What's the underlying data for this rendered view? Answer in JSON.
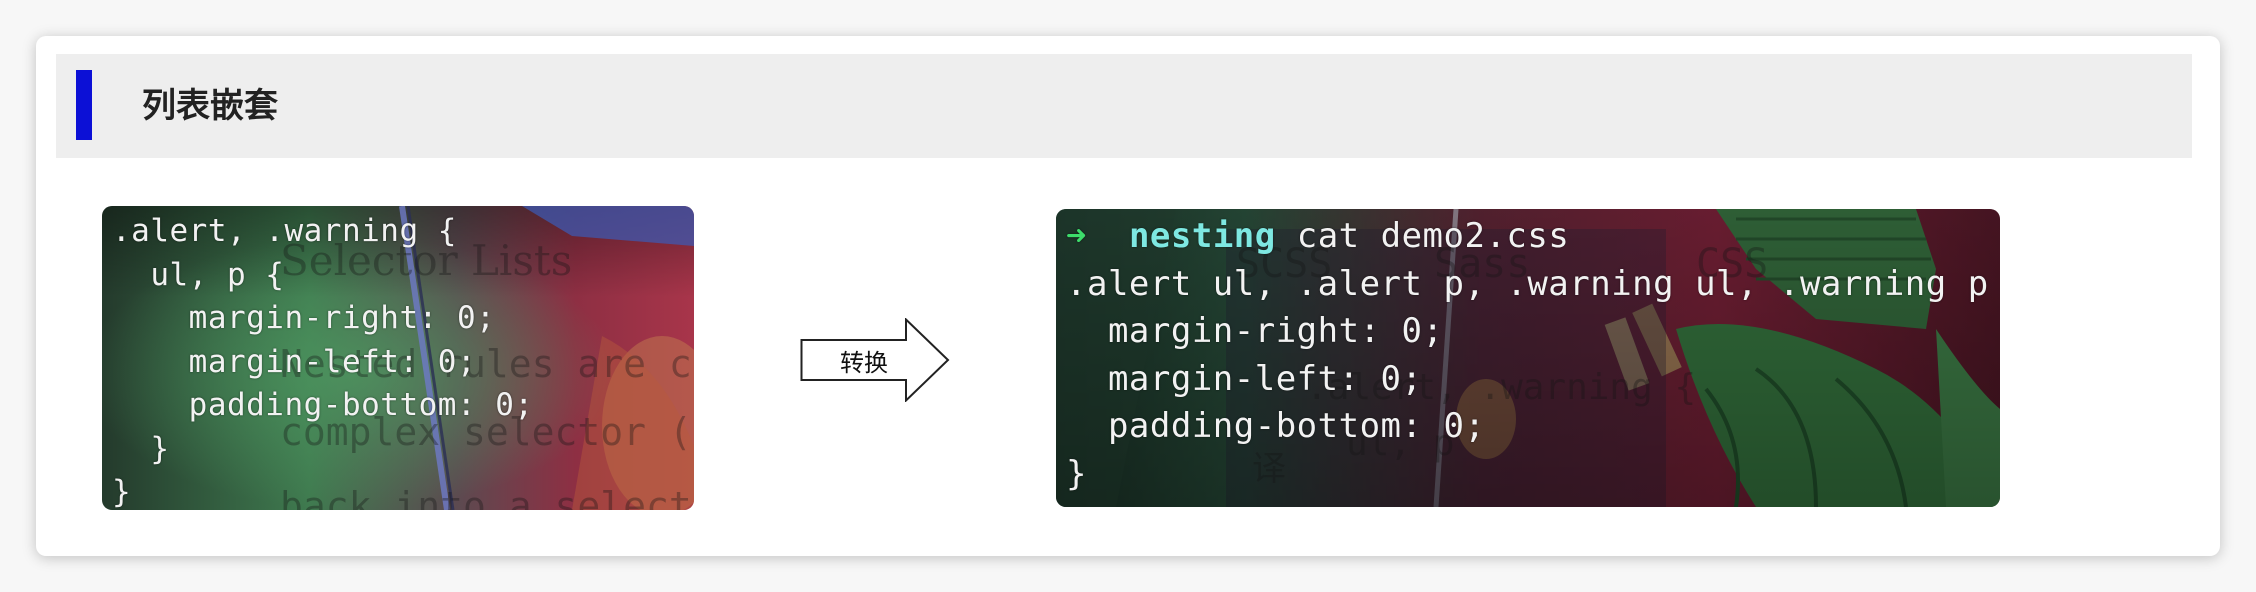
{
  "section": {
    "title": "列表嵌套",
    "accent_color": "#0c10d6"
  },
  "left_terminal": {
    "lines": [
      ".alert, .warning {",
      "  ul, p {",
      "    margin-right: 0;",
      "    margin-left: 0;",
      "    padding-bottom: 0;",
      "  }",
      "}"
    ],
    "background_text": [
      "Selector Lists",
      "Nested rules are clever",
      "complex selector (the",
      "back into a selector li"
    ]
  },
  "transform_arrow": {
    "label": "转换",
    "icon": "right-arrow-icon"
  },
  "right_terminal": {
    "prompt_symbol": "➜",
    "prompt_dir": "nesting",
    "command": "cat demo2.css",
    "output_lines": [
      ".alert ul, .alert p, .warning ul, .warning p {",
      "  margin-right: 0;",
      "  margin-left: 0;",
      "  padding-bottom: 0;",
      "}"
    ],
    "background_text": [
      "SCSS",
      "Sass",
      "CSS",
      ".alert, .warning {",
      "ul, p",
      "译"
    ]
  }
}
